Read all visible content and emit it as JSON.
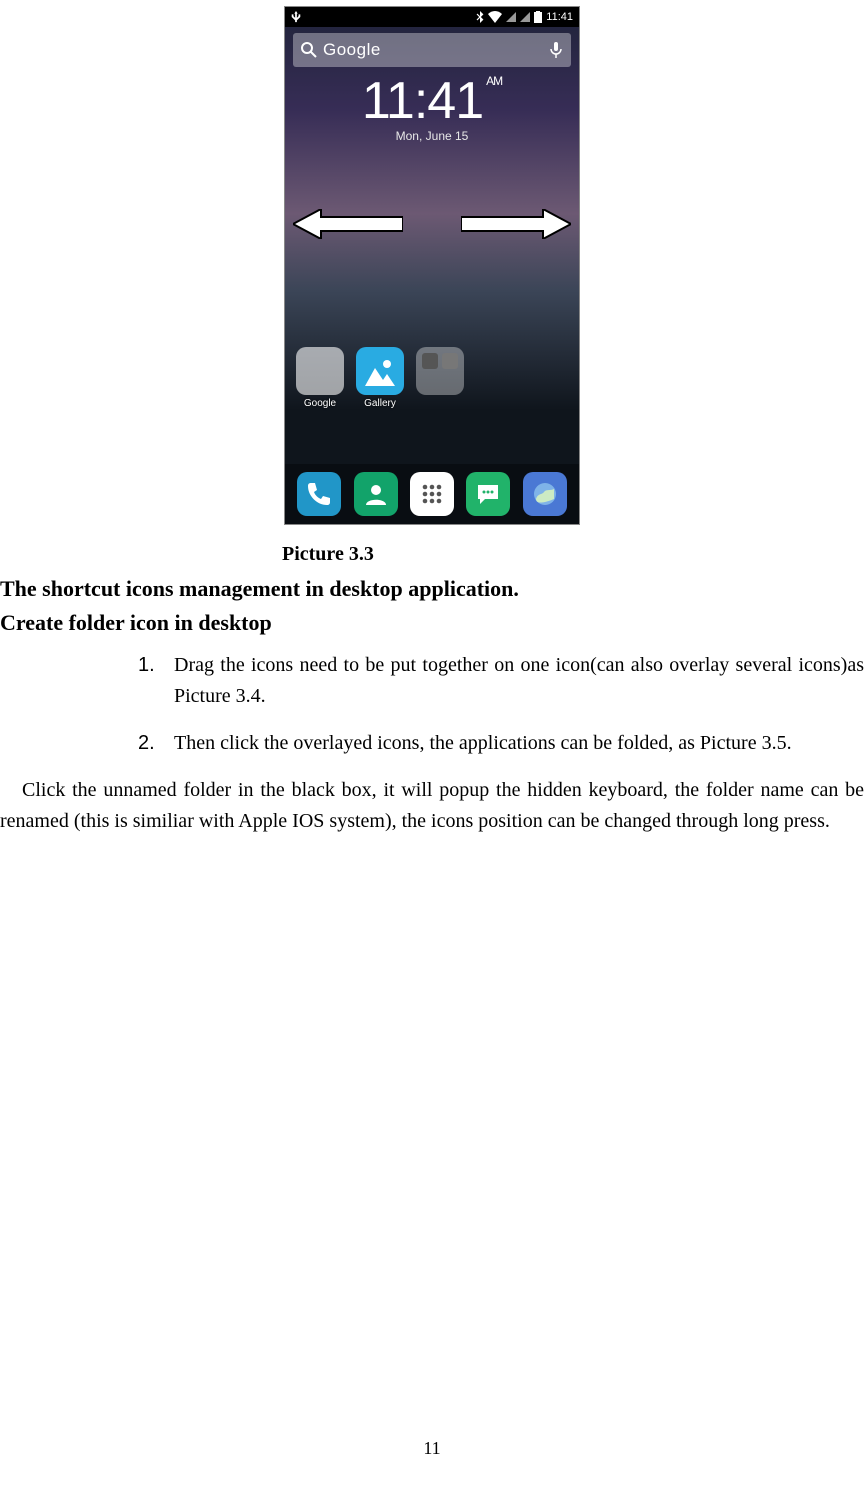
{
  "screenshot": {
    "statusbar": {
      "time": "11:41"
    },
    "search": {
      "label": "Google"
    },
    "clock": {
      "time": "11:41",
      "ampm": "AM",
      "date": "Mon, June 15"
    },
    "apps": {
      "google_label": "Google",
      "gallery_label": "Gallery"
    }
  },
  "caption": "Picture 3.3",
  "heading_major": "The shortcut icons management in desktop application.",
  "heading_minor": "Create folder icon in desktop",
  "steps": [
    "Drag the icons need to be put together on one icon(can also overlay several icons)as Picture 3.4.",
    "Then click the overlayed icons, the applications can be folded, as Picture 3.5."
  ],
  "paragraph": "Click the unnamed folder in the black box, it will popup the hidden keyboard, the folder name can be renamed (this is similiar with Apple IOS system), the icons position can be changed through long press.",
  "page_number": "11"
}
